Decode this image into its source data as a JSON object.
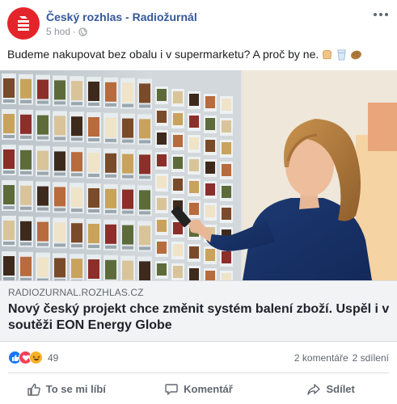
{
  "post": {
    "page_name": "Český rozhlas - Radiožurnál",
    "time": "5 hod",
    "separator": "·",
    "privacy_icon": "globe-icon",
    "text": "Budeme nakupovat bez obalu i v supermarketu? A proč by ne.",
    "emojis": [
      "bread-icon",
      "cup-icon",
      "potato-icon"
    ]
  },
  "link": {
    "domain": "RADIOZURNAL.ROZHLAS.CZ",
    "title": "Nový český projekt chce změnit systém balení zboží. Uspěl i v soutěži EON Energy Globe"
  },
  "stats": {
    "reactions": [
      "like-icon",
      "love-icon",
      "haha-icon"
    ],
    "reaction_count": "49",
    "comments": "2 komentáře",
    "shares": "2 sdílení"
  },
  "actions": {
    "like": "To se mi líbí",
    "comment": "Komentář",
    "share": "Sdílet"
  },
  "colors": {
    "brand_red": "#e3252b",
    "link_blue": "#365899",
    "like_blue": "#1877f2"
  }
}
